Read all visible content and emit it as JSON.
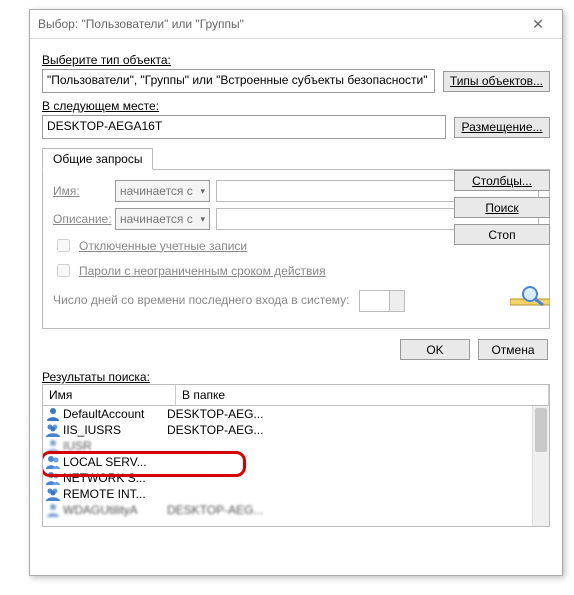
{
  "title": "Выбор: \"Пользователи\" или \"Группы\"",
  "labels": {
    "select_object_type": "Выберите тип объекта:",
    "object_type_value": "\"Пользователи\", \"Группы\" или \"Встроенные субъекты безопасности\"",
    "object_types_btn": "Типы объектов...",
    "location_label": "В следующем месте:",
    "location_value": "DESKTOP-AEGA16T",
    "location_btn": "Размещение...",
    "tab_common": "Общие запросы",
    "name": "Имя:",
    "desc": "Описание:",
    "starts_with": "начинается с",
    "chk_disabled": "Отключенные учетные записи",
    "chk_nopwexp": "Пароли с неограниченным сроком действия",
    "days_label": "Число дней со времени последнего входа в систему:",
    "columns_btn": "Столбцы...",
    "find_btn": "Поиск",
    "stop_btn": "Стоп",
    "ok": "OK",
    "cancel": "Отмена",
    "results": "Результаты поиска:",
    "col_name": "Имя",
    "col_folder": "В папке"
  },
  "results_rows": [
    {
      "icon": "single",
      "name": "DefaultAccount",
      "folder": "DESKTOP-AEG...",
      "blur": false
    },
    {
      "icon": "group",
      "name": "IIS_IUSRS",
      "folder": "DESKTOP-AEG...",
      "blur": false
    },
    {
      "icon": "single",
      "name": "IUSR",
      "folder": "",
      "blur": true
    },
    {
      "icon": "two",
      "name": "LOCAL SERV...",
      "folder": "",
      "blur": false,
      "highlight": true
    },
    {
      "icon": "two",
      "name": "NETWORK S...",
      "folder": "",
      "blur": false
    },
    {
      "icon": "group",
      "name": "REMOTE INT...",
      "folder": "",
      "blur": false
    },
    {
      "icon": "single",
      "name": "WDAGUtilityA",
      "folder": "DESKTOP-AEG...",
      "blur": true
    }
  ]
}
